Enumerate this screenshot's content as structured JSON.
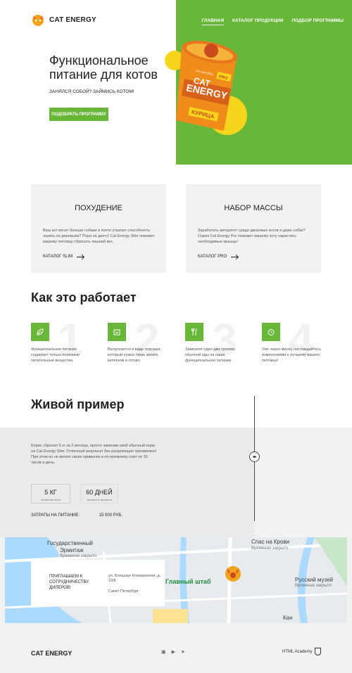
{
  "header": {
    "logo_text": "CAT ENERGY",
    "nav": [
      "ГЛАВНАЯ",
      "КАТАЛОГ ПРОДУКЦИИ",
      "ПОДБОР ПРОГРАММЫ"
    ]
  },
  "hero": {
    "title": "Функциональное питание для котов",
    "subtitle": "ЗАНЯЛСЯ СОБОЙ? ЗАЙМИСЬ КОТОМ!",
    "button": "ПОДОБРАТЬ ПРОГРАММУ",
    "can": {
      "line1": "CAT",
      "line2": "ENERGY",
      "badge": "PRO",
      "flavor": "КУРИЦА",
      "natural": "0% NATURAL"
    }
  },
  "programs": [
    {
      "title": "ПОХУДЕНИЕ",
      "text": "Ваш кот весит больше собаки и почти утратил способность лазить по деревьям? Пора на диету! Cat Energy Slim поможет вашему питомцу сбросить лишний вес.",
      "link": "КАТАЛОГ SLIM"
    },
    {
      "title": "НАБОР МАССЫ",
      "text": "Заработать авторитет среди дворовых котов и даже собак? Серия Cat Energy Pro поможет вашему коту нарастить необходимые мышцы!",
      "link": "КАТАЛОГ PRO"
    }
  ],
  "how": {
    "title": "Как это работает",
    "steps": [
      {
        "num": "1",
        "icon": "leaf-icon",
        "text": "Функциональное питание содержит только полезные питательные вещества."
      },
      {
        "num": "2",
        "icon": "package-icon",
        "text": "Выпускается в виде порошка, который нужно лишь залить кипятком и готово."
      },
      {
        "num": "3",
        "icon": "cutlery-icon",
        "text": "Замените один-два приема обычной еды на наше функциональное питание."
      },
      {
        "num": "4",
        "icon": "clock-icon",
        "text": "Уже через месяц наслаждайтесь изменениями к лучшему вашего питомца!"
      }
    ]
  },
  "live": {
    "title": "Живой пример",
    "text": "Борис сбросил 5 кг за 2 месяца, просто заменив свой обычный корм на Cat Energy Slim. Отличный результат без изнуряющих тренировок! При этом он не менял своих привычек и по-прежнему спит по 16 часов в день.",
    "stats": [
      {
        "value": "5 КГ",
        "label": "снижение веса"
      },
      {
        "value": "60 ДНЕЙ",
        "label": "затрачено времени"
      }
    ],
    "cost_label": "ЗАТРАТЫ НА ПИТАНИЕ:",
    "cost_value": "15 000 РУБ."
  },
  "map": {
    "card_title": "ПРИГЛАШАЕМ К СОТРУДНИЧЕСТВУ ДИЛЕРОВ!",
    "address": "ул. Большая Конюшенная, д. 19/8",
    "city": "Санкт-Петербург",
    "labels": [
      "Государственный",
      "Эрмитаж",
      "Временно закрыто",
      "Спас на Крови",
      "Временно закрыто",
      "Русский музей",
      "Временно закрыто",
      "Главный штаб",
      "Кан"
    ]
  },
  "footer": {
    "logo_text": "CAT ENERGY",
    "academy": "HTML Academy"
  },
  "colors": {
    "accent": "#68b738"
  }
}
